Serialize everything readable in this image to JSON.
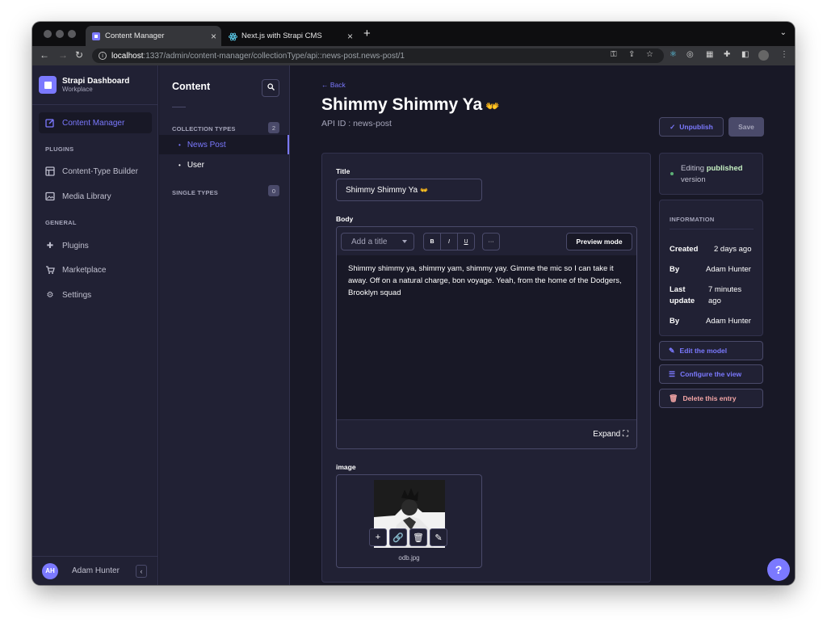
{
  "browser": {
    "tabs": [
      {
        "title": "Content Manager"
      },
      {
        "title": "Next.js with Strapi CMS"
      }
    ],
    "url_host": "localhost",
    "url_path": ":1337/admin/content-manager/collectionType/api::news-post.news-post/1",
    "new_tab": "+",
    "close": "×"
  },
  "nav": {
    "brand_title": "Strapi Dashboard",
    "brand_sub": "Workplace",
    "content_manager": "Content Manager",
    "plugins_heading": "PLUGINS",
    "content_type_builder": "Content-Type Builder",
    "media_library": "Media Library",
    "general_heading": "GENERAL",
    "plugins": "Plugins",
    "marketplace": "Marketplace",
    "settings": "Settings",
    "user_initials": "AH",
    "user_name": "Adam Hunter"
  },
  "subnav": {
    "title": "Content",
    "collection_types": "COLLECTION TYPES",
    "collection_count": "2",
    "news_post": "News Post",
    "user": "User",
    "single_types": "SINGLE TYPES",
    "single_count": "0"
  },
  "main": {
    "back": "Back",
    "title": "Shimmy Shimmy Ya",
    "api_id": "API ID : news-post",
    "unpublish": "Unpublish",
    "save": "Save",
    "title_label": "Title",
    "title_value": "Shimmy Shimmy Ya",
    "body_label": "Body",
    "add_title": "Add a title",
    "bold": "B",
    "italic": "I",
    "underline": "U",
    "more": "···",
    "preview_mode": "Preview mode",
    "body_text": "Shimmy shimmy ya, shimmy yam, shimmy yay. Gimme the mic so I can take it away. Off on a natural charge, bon voyage. Yeah, from the home of the Dodgers, Brooklyn squad",
    "expand": "Expand",
    "image_label": "image",
    "file_name": "odb.jpg"
  },
  "side": {
    "editing_prefix": "Editing",
    "editing_state": "published",
    "editing_suffix": "version",
    "info_heading": "INFORMATION",
    "created_label": "Created",
    "created_value": "2 days ago",
    "by_label": "By",
    "created_by": "Adam Hunter",
    "last_update_label": "Last update",
    "last_update_value": "7 minutes ago",
    "updated_by": "Adam Hunter",
    "edit_model": "Edit the model",
    "configure_view": "Configure the view",
    "delete_entry": "Delete this entry"
  },
  "help": "?",
  "colors": {
    "accent": "#7b79ff",
    "bg": "#181826",
    "panel": "#212134",
    "border": "#4a4a6a"
  }
}
